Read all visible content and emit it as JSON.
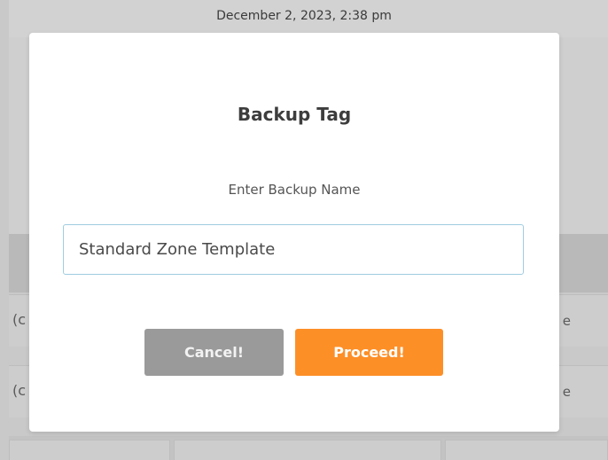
{
  "background": {
    "timestamp": "December 2, 2023, 2:38 pm",
    "rows": [
      {
        "left_fragment": "(c",
        "right_fragment": "e"
      },
      {
        "left_fragment": "(c",
        "right_fragment": "e"
      }
    ]
  },
  "modal": {
    "title": "Backup Tag",
    "prompt": "Enter Backup Name",
    "input_value": "Standard Zone Template",
    "cancel_label": "Cancel!",
    "proceed_label": "Proceed!"
  },
  "colors": {
    "proceed": "#fd8f27",
    "cancel": "#9a9a9a",
    "input_border": "#9ecde0"
  }
}
